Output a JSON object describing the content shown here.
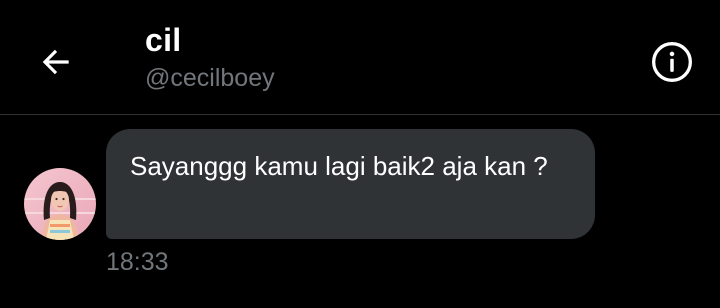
{
  "header": {
    "back_icon": "arrow-left-icon",
    "name": "cil",
    "handle": "@cecilboey",
    "info_icon": "info-circle-icon"
  },
  "conversation": {
    "messages": [
      {
        "text": "Sayanggg kamu lagi baik2 aja kan ?",
        "time": "18:33",
        "direction": "received"
      }
    ]
  },
  "colors": {
    "background": "#000000",
    "bubble": "#2f3336",
    "secondary_text": "#71767b",
    "divider": "#2f3336"
  }
}
